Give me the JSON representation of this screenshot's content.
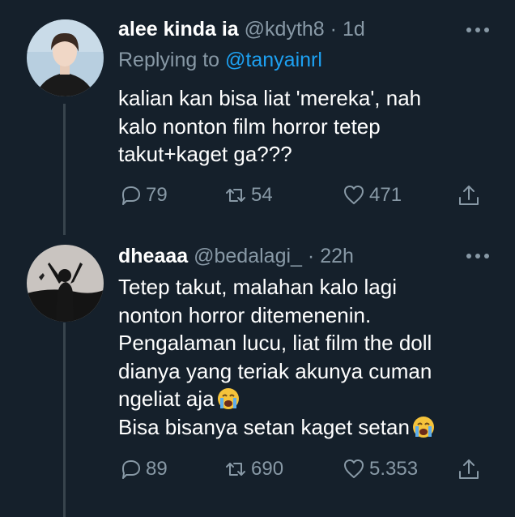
{
  "tweets": [
    {
      "name": "alee kinda ia",
      "handle": "@kdyth8",
      "dot": "·",
      "time": "1d",
      "replying_prefix": "Replying to",
      "replying_to": "@tanyainrl",
      "lines": [
        "kalian kan bisa liat 'mereka', nah",
        "kalo nonton film horror tetep",
        "takut+kaget ga???"
      ],
      "replies": "79",
      "retweets": "54",
      "likes": "471"
    },
    {
      "name": "dheaaa",
      "handle": "@bedalagi_",
      "dot": "·",
      "time": "22h",
      "lines": [
        "Tetep takut, malahan kalo lagi",
        "nonton horror ditemenenin.",
        "Pengalaman lucu, liat film the doll",
        "dianya yang teriak akunya cuman",
        "ngeliat aja",
        "Bisa bisanya setan kaget setan"
      ],
      "replies": "89",
      "retweets": "690",
      "likes": "5.353"
    }
  ],
  "icons": {
    "more": "more-dots-icon",
    "reply": "reply-bubble-icon",
    "retweet": "retweet-icon",
    "like": "heart-icon",
    "share": "share-icon",
    "emoji": "loudly-crying-face-emoji"
  },
  "colors": {
    "background": "#15202b",
    "text": "#ffffff",
    "secondary": "#8899a6",
    "link": "#1da1f2",
    "thread_line": "#38444d"
  }
}
